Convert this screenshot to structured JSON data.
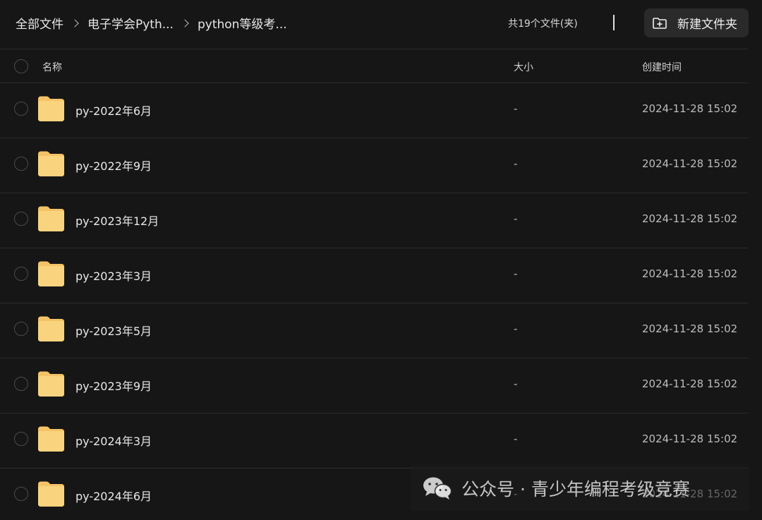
{
  "breadcrumb": [
    "全部文件",
    "电子学会Pyth...",
    "python等级考..."
  ],
  "file_count": "共19个文件(夹)",
  "new_folder_button": "新建文件夹",
  "columns": {
    "name": "名称",
    "size": "大小",
    "created": "创建时间"
  },
  "files": [
    {
      "name": "py-2022年6月",
      "size": "-",
      "created": "2024-11-28 15:02"
    },
    {
      "name": "py-2022年9月",
      "size": "-",
      "created": "2024-11-28 15:02"
    },
    {
      "name": "py-2023年12月",
      "size": "-",
      "created": "2024-11-28 15:02"
    },
    {
      "name": "py-2023年3月",
      "size": "-",
      "created": "2024-11-28 15:02"
    },
    {
      "name": "py-2023年5月",
      "size": "-",
      "created": "2024-11-28 15:02"
    },
    {
      "name": "py-2023年9月",
      "size": "-",
      "created": "2024-11-28 15:02"
    },
    {
      "name": "py-2024年3月",
      "size": "-",
      "created": "2024-11-28 15:02"
    },
    {
      "name": "py-2024年6月",
      "size": "-",
      "created": "2024-11-28 15:02"
    }
  ],
  "watermark": "公众号 · 青少年编程考级竞赛",
  "colors": {
    "background": "#161616",
    "folder": "#f4c267",
    "button_bg": "#2a2a2a"
  },
  "icons": {
    "folder": "folder-icon",
    "new_folder": "folder-plus-icon",
    "watermark": "wechat-icon"
  }
}
